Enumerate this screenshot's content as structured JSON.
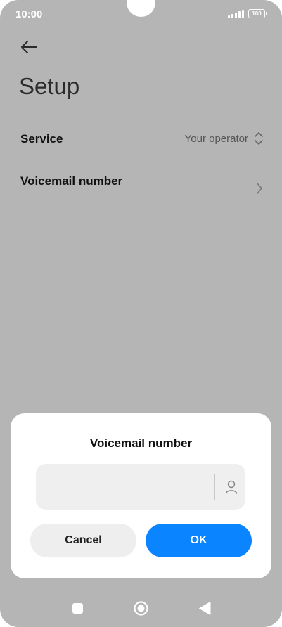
{
  "status_bar": {
    "time": "10:00",
    "battery": "100"
  },
  "header": {
    "back_icon": "arrow-left-icon",
    "title": "Setup"
  },
  "settings": {
    "service": {
      "label": "Service",
      "value": "Your operator",
      "icon": "up-down-chevron-icon"
    },
    "voicemail": {
      "label": "Voicemail number",
      "icon": "chevron-right-icon"
    }
  },
  "dialog": {
    "title": "Voicemail number",
    "input_value": "",
    "contact_icon": "contact-person-icon",
    "cancel_label": "Cancel",
    "ok_label": "OK",
    "ok_color": "#0a84ff"
  },
  "nav_bar": {
    "recents_icon": "square-icon",
    "home_icon": "circle-home-icon",
    "back_icon": "triangle-back-icon"
  }
}
